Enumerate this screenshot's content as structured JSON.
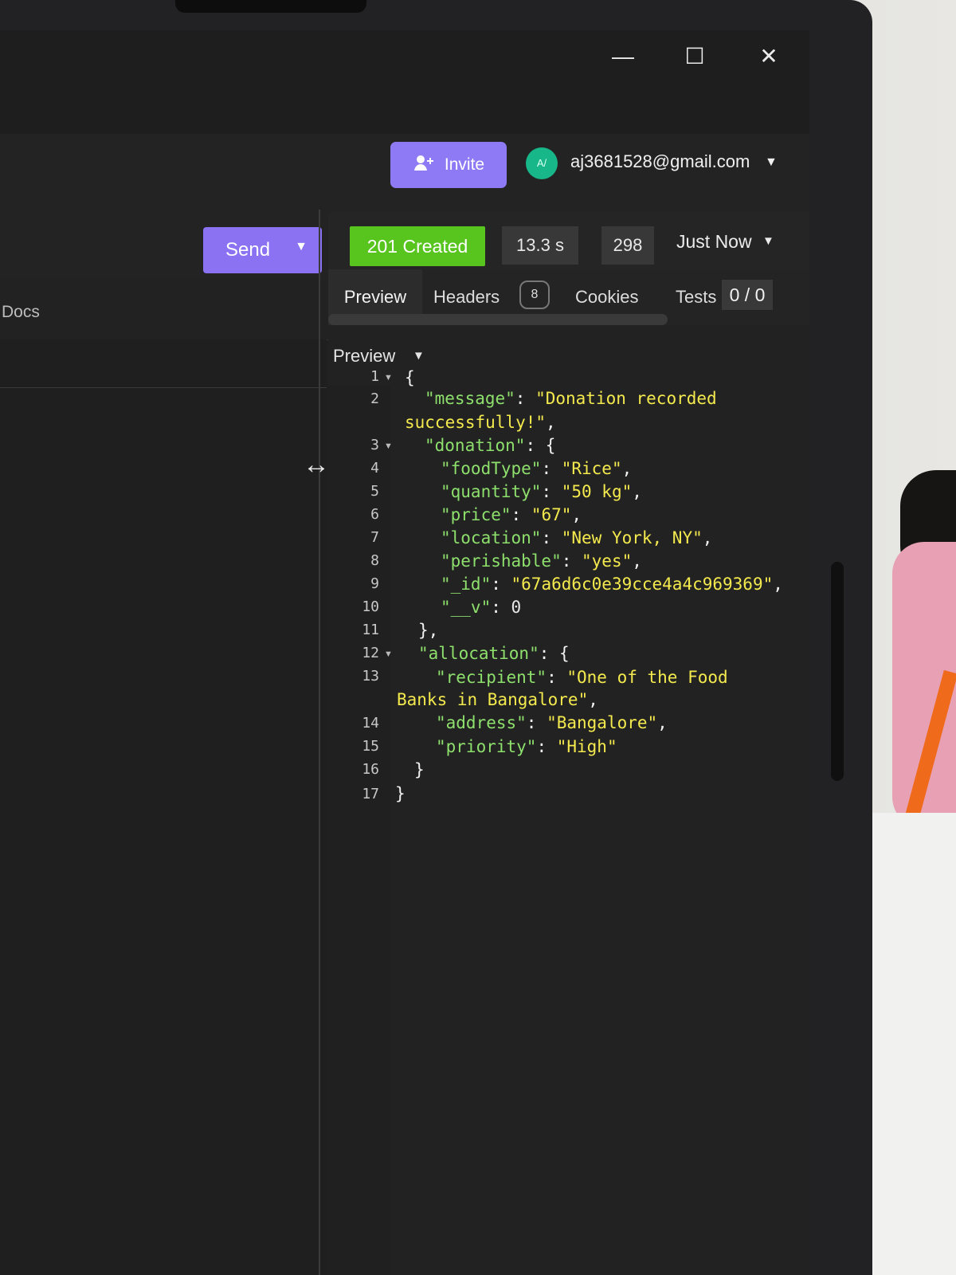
{
  "window": {
    "minimize_symbol": "—",
    "maximize_symbol": "☐",
    "close_symbol": "✕"
  },
  "topbar": {
    "invite_label": "Invite",
    "invite_icon": "person-plus-icon",
    "avatar_initials": "A/",
    "email": "aj3681528@gmail.com",
    "dropdown_icon": "chevron-down-icon"
  },
  "request": {
    "send_label": "Send",
    "send_dropdown_icon": "chevron-down-icon",
    "docs_label": "Docs"
  },
  "response": {
    "status": "201 Created",
    "time": "13.3 s",
    "size": "298",
    "history": "Just Now",
    "history_dropdown_icon": "chevron-down-icon",
    "status_color": "#58c51f"
  },
  "tabs": {
    "preview": "Preview",
    "headers": "Headers",
    "headers_count": "8",
    "cookies": "Cookies",
    "tests": "Tests",
    "tests_count": "0 / 0"
  },
  "preview_mode": {
    "label": "Preview",
    "dropdown_icon": "chevron-down-icon"
  },
  "editor": {
    "line_numbers": [
      "1",
      "2",
      "3",
      "4",
      "5",
      "6",
      "7",
      "8",
      "9",
      "10",
      "11",
      "12",
      "13",
      "14",
      "15",
      "16",
      "17"
    ],
    "lines": [
      [
        "{"
      ],
      [
        "\"message\"",
        ": ",
        "\"Donation recorded"
      ],
      [
        "successfully!\"",
        ","
      ],
      [
        "\"donation\"",
        ": {"
      ],
      [
        "\"foodType\"",
        ": ",
        "\"Rice\"",
        ","
      ],
      [
        "\"quantity\"",
        ": ",
        "\"50 kg\"",
        ","
      ],
      [
        "\"price\"",
        ": ",
        "\"67\"",
        ","
      ],
      [
        "\"location\"",
        ": ",
        "\"New York, NY\"",
        ","
      ],
      [
        "\"perishable\"",
        ": ",
        "\"yes\"",
        ","
      ],
      [
        "\"_id\"",
        ": ",
        "\"67a6d6c0e39cce4a4c969369\"",
        ","
      ],
      [
        "\"__v\"",
        ": ",
        "0"
      ],
      [
        "},"
      ],
      [
        "\"allocation\"",
        ": {"
      ],
      [
        "\"recipient\"",
        ": ",
        "\"One of the Food"
      ],
      [
        "Banks in Bangalore\"",
        ","
      ],
      [
        "\"address\"",
        ": ",
        "\"Bangalore\"",
        ","
      ],
      [
        "\"priority\"",
        ": ",
        "\"High\""
      ],
      [
        "}"
      ],
      [
        "}"
      ]
    ]
  }
}
